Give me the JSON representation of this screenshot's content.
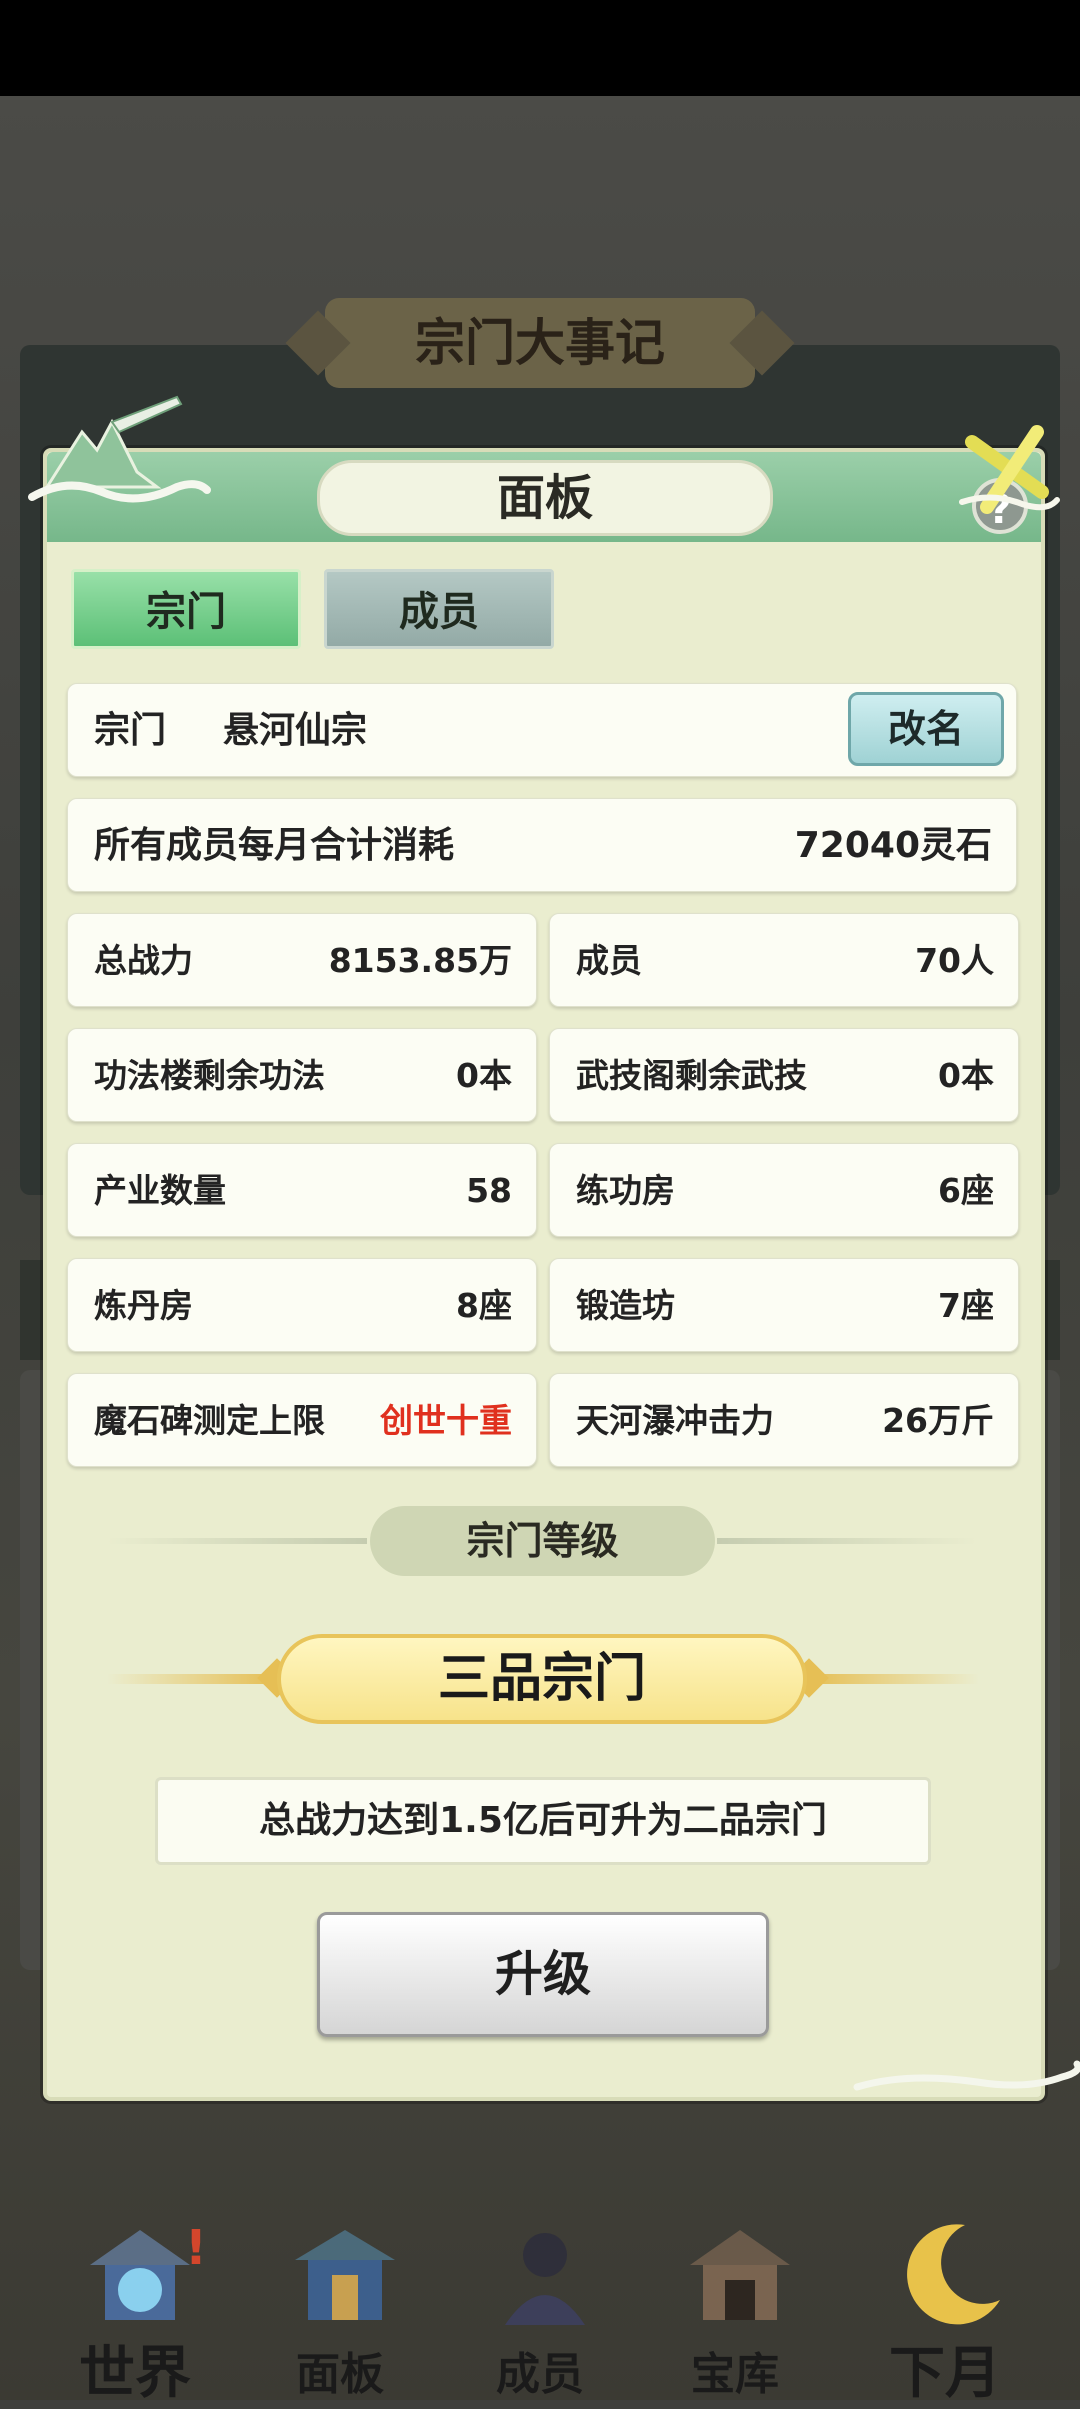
{
  "background": {
    "event_log_title": "宗门大事记"
  },
  "panel": {
    "title": "面板",
    "help_icon": "question-icon",
    "tabs": [
      {
        "label": "宗门",
        "active": true
      },
      {
        "label": "成员",
        "active": false
      }
    ],
    "sect": {
      "label": "宗门",
      "name": "悬河仙宗",
      "rename_label": "改名"
    },
    "monthly_cost": {
      "label": "所有成员每月合计消耗",
      "value": "72040灵石"
    },
    "stats": [
      {
        "label": "总战力",
        "value": "8153.85万"
      },
      {
        "label": "成员",
        "value": "70人"
      },
      {
        "label": "功法楼剩余功法",
        "value": "0本"
      },
      {
        "label": "武技阁剩余武技",
        "value": "0本"
      },
      {
        "label": "产业数量",
        "value": "58"
      },
      {
        "label": "练功房",
        "value": "6座"
      },
      {
        "label": "炼丹房",
        "value": "8座"
      },
      {
        "label": "锻造坊",
        "value": "7座"
      },
      {
        "label": "魔石碑测定上限",
        "value": "创世十重",
        "value_color": "#e0301e"
      },
      {
        "label": "天河瀑冲击力",
        "value": "26万斤"
      }
    ],
    "level": {
      "section_label": "宗门等级",
      "rank": "三品宗门",
      "hint": "总战力达到1.5亿后可升为二品宗门",
      "upgrade_label": "升级"
    }
  },
  "nav": {
    "items": [
      {
        "label": "世界",
        "icon": "world-icon",
        "badge": "!"
      },
      {
        "label": "面板",
        "icon": "panel-icon"
      },
      {
        "label": "成员",
        "icon": "members-icon"
      },
      {
        "label": "宝库",
        "icon": "treasury-icon"
      },
      {
        "label": "下月",
        "icon": "next-month-icon"
      }
    ]
  }
}
